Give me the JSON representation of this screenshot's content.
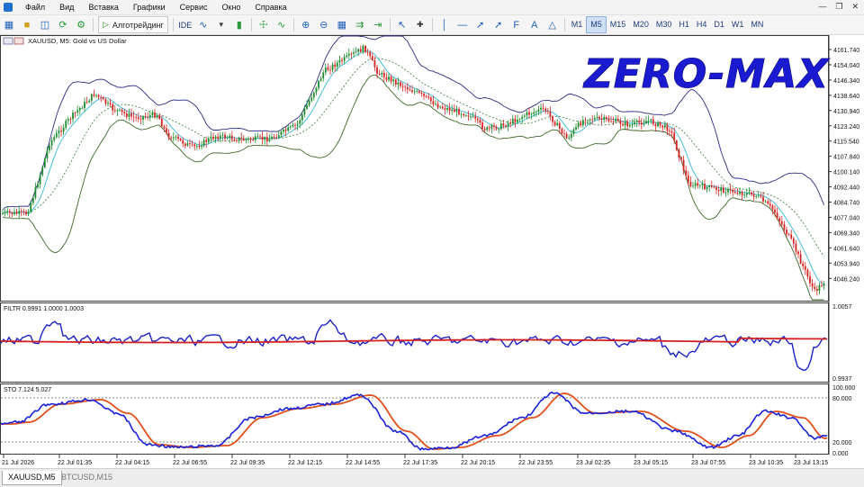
{
  "menu": [
    "Файл",
    "Вид",
    "Вставка",
    "Графики",
    "Сервис",
    "Окно",
    "Справка"
  ],
  "toolbar": {
    "algo_label": "Алготрейдинг",
    "ide_label": "IDE",
    "timeframes": [
      "M1",
      "M5",
      "M15",
      "M20",
      "M30",
      "H1",
      "H4",
      "D1",
      "W1",
      "MN"
    ],
    "active_timeframe": "M5"
  },
  "chart": {
    "symbol_title": "XAUUSD, M5:  Gold vs US Dollar",
    "watermark": "ZERO-MAX",
    "price_ticks": [
      "4161.740",
      "4154.040",
      "4146.340",
      "4138.640",
      "4130.940",
      "4123.240",
      "4115.540",
      "4107.840",
      "4100.140",
      "4092.440",
      "4084.740",
      "4077.040",
      "4069.340",
      "4061.640",
      "4053.940",
      "4046.240"
    ],
    "filter_label": "FILTR 0.9991 1.0000 1.0003",
    "filter_ticks": [
      "1.0057",
      "0.9937"
    ],
    "sto_label": "STO 7.124 5.027",
    "sto_ticks": [
      "100.000",
      "80.000",
      "20.000",
      "0.000"
    ],
    "time_ticks": [
      "21 Jul 2026",
      "22 Jul 01:35",
      "22 Jul 04:15",
      "22 Jul 06:55",
      "22 Jul 09:35",
      "22 Jul 12:15",
      "22 Jul 14:55",
      "22 Jul 17:35",
      "22 Jul 20:15",
      "22 Jul 23:55",
      "23 Jul 02:35",
      "23 Jul 05:15",
      "23 Jul 07:55",
      "23 Jul 10:35",
      "23 Jul 13:15"
    ],
    "colors": {
      "candle_up": "#1e8c2e",
      "candle_down": "#d42525",
      "bb_upper": "#2b2b86",
      "bb_lower": "#3a6a2a",
      "ma_fast": "#35b8d8",
      "ma_slow": "#4a8a4a",
      "filter_line": "#1a22c8",
      "filter_signal": "#d42020",
      "sto_main": "#1a22d8",
      "sto_signal": "#e0501a",
      "watermark": "#1a1ad0"
    }
  },
  "chart_data": {
    "type": "line",
    "title": "XAUUSD, M5:  Gold vs US Dollar",
    "ylim": [
      4040,
      4168
    ],
    "x": [
      "21 Jul 2026",
      "22 Jul 01:35",
      "22 Jul 04:15",
      "22 Jul 06:55",
      "22 Jul 09:35",
      "22 Jul 12:15",
      "22 Jul 14:55",
      "22 Jul 17:35",
      "22 Jul 20:15",
      "22 Jul 23:55",
      "23 Jul 02:35",
      "23 Jul 05:15",
      "23 Jul 07:55",
      "23 Jul 10:35",
      "23 Jul 13:15"
    ],
    "series": [
      {
        "values": [
          4085,
          4134,
          4128,
          4115,
          4118,
          4121,
          4158,
          4133,
          4125,
          4129,
          4129,
          4127,
          4095,
          4091,
          4048
        ]
      }
    ]
  },
  "tabs": [
    "XAUUSD,M5",
    "BTCUSD,M15"
  ]
}
